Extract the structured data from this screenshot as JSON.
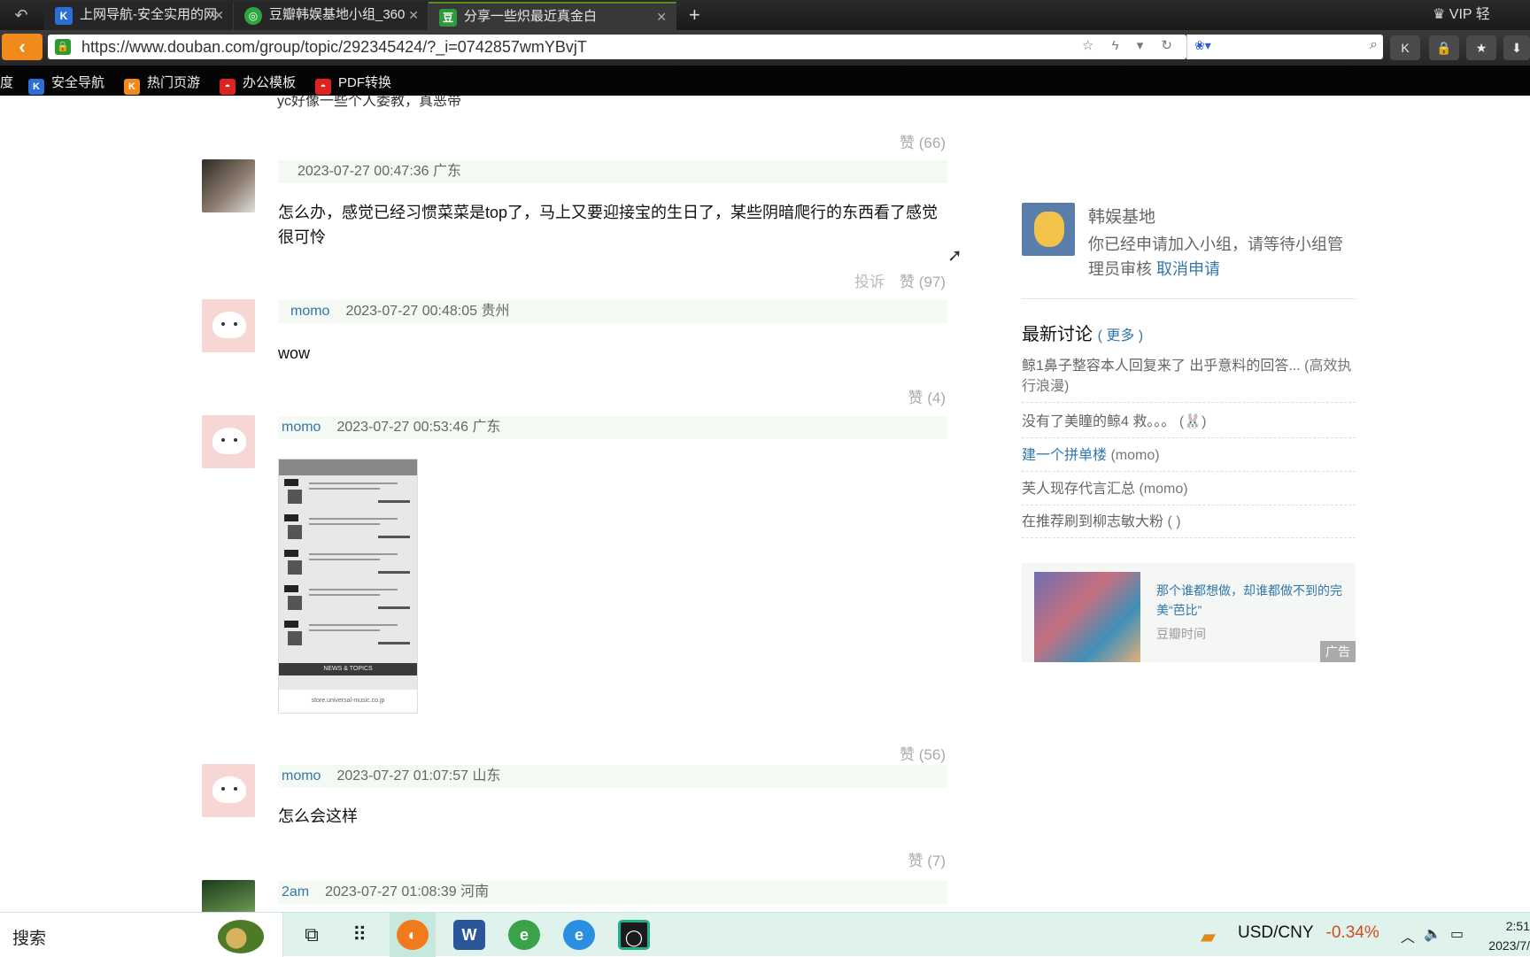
{
  "browser": {
    "tabs": [
      {
        "title": "上网导航-安全实用的网",
        "icon": "shield-icon"
      },
      {
        "title": "豆瓣韩娱基地小组_360",
        "icon": "360-icon"
      },
      {
        "title": "分享一些炽最近真金白",
        "icon": "douban-icon",
        "favicon_text": "豆"
      }
    ],
    "vip_label": "VIP 轻",
    "url": "https://www.douban.com/group/topic/292345424/?_i=0742857wmYBvjT",
    "bookmarks": [
      {
        "label": "度"
      },
      {
        "label": "安全导航"
      },
      {
        "label": "热门页游"
      },
      {
        "label": "办公模板"
      },
      {
        "label": "PDF转换"
      }
    ]
  },
  "comments": {
    "partial_text": "yc好像一些个人委教，真恶带",
    "like_top": "赞 (66)",
    "items": [
      {
        "author": "",
        "time": "2023-07-27 00:47:36 广东",
        "text": "怎么办，感觉已经习惯菜菜是top了，马上又要迎接宝的生日了，某些阴暗爬行的东西看了感觉很可怜",
        "report": "投诉",
        "like": "赞 (97)"
      },
      {
        "author": "momo",
        "time": "2023-07-27 00:48:05 贵州",
        "text": "wow",
        "like": "赞 (4)"
      },
      {
        "author": "momo",
        "time": "2023-07-27 00:53:46 广东",
        "text": "",
        "like": "赞 (56)"
      },
      {
        "author": "momo",
        "time": "2023-07-27 01:07:57 山东",
        "text": "怎么会这样",
        "like": "赞 (7)"
      },
      {
        "author": "2am",
        "time": "2023-07-27 01:08:39 河南",
        "text": "",
        "like": ""
      }
    ],
    "image": {
      "news_label": "NEWS & TOPICS",
      "footer": "store.universal-music.co.jp"
    }
  },
  "sidebar": {
    "group_name": "韩娱基地",
    "status_text": "你已经申请加入小组，请等待小组管理员审核",
    "cancel_label": "取消申请",
    "discussions_title": "最新讨论",
    "more_label": "( 更多 )",
    "discussions": [
      {
        "title": "鲸1鼻子整容本人回复来了 出乎意料的回答...",
        "by": "(高效执行浪漫)"
      },
      {
        "title": "没有了美瞳的鲸4 救。。。",
        "by": "(🐰)"
      },
      {
        "title": "建一个拼单楼",
        "by": "(momo)"
      },
      {
        "title": "芙人现存代言汇总",
        "by": "(momo)"
      },
      {
        "title": "在推荐刷到柳志敏大粉",
        "by": "(  )"
      }
    ],
    "ad": {
      "headline": "那个谁都想做，却谁都做不到的完美“芭比”",
      "source": "豆瓣时间",
      "tag": "广告"
    }
  },
  "taskbar": {
    "search_label": "搜索",
    "fx_pair": "USD/CNY",
    "fx_change": "-0.34%",
    "clock_time": "2:51",
    "clock_date": "2023/7/"
  }
}
